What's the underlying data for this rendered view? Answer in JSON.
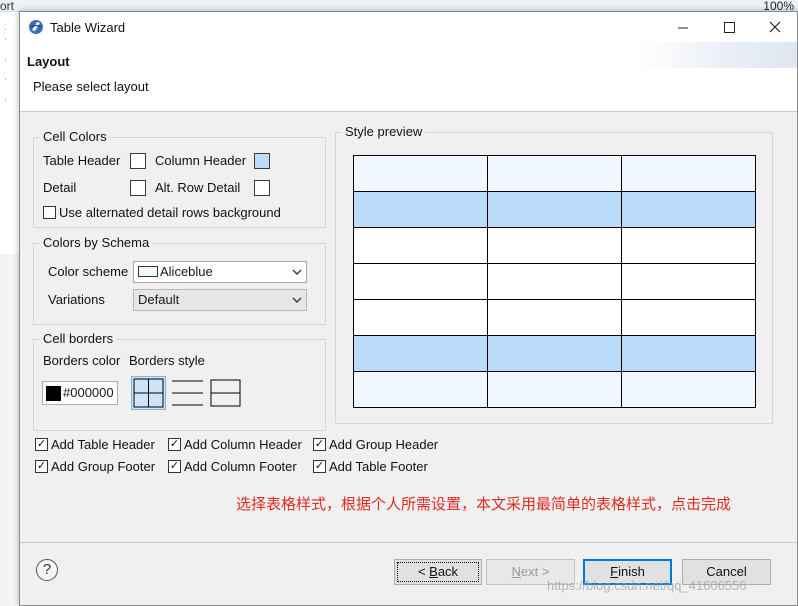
{
  "background": {
    "tab_fragment": "ort",
    "zoom": "100%"
  },
  "window": {
    "title": "Table Wizard",
    "controls": {
      "minimize": "—",
      "maximize": "☐",
      "close": "✕"
    }
  },
  "page": {
    "title": "Layout",
    "description": "Please select layout"
  },
  "cell_colors": {
    "group_label": "Cell Colors",
    "table_header_label": "Table Header",
    "column_header_label": "Column Header",
    "detail_label": "Detail",
    "alt_row_detail_label": "Alt. Row Detail",
    "alternated_checkbox_label": "Use alternated detail rows background",
    "colors": {
      "table_header": "#ffffff",
      "column_header": "#bbdcf8",
      "detail": "#ffffff",
      "alt_row_detail": "#ffffff"
    }
  },
  "schema": {
    "group_label": "Colors by Schema",
    "color_scheme_label": "Color scheme",
    "color_scheme_value": "Aliceblue",
    "variations_label": "Variations",
    "variations_value": "Default"
  },
  "cell_borders": {
    "group_label": "Cell borders",
    "borders_color_label": "Borders color",
    "borders_style_label": "Borders style",
    "color_value": "#000000"
  },
  "preview": {
    "group_label": "Style preview",
    "row_colors": [
      "#f0f7fe",
      "#bbdcf8",
      "#ffffff",
      "#ffffff",
      "#ffffff",
      "#bbdcf8",
      "#f0f7fe"
    ]
  },
  "options": [
    {
      "label": "Add Table Header",
      "checked": true
    },
    {
      "label": "Add Column Header",
      "checked": true
    },
    {
      "label": "Add Group Header",
      "checked": true
    },
    {
      "label": "Add Group Footer",
      "checked": true
    },
    {
      "label": "Add Column Footer",
      "checked": true
    },
    {
      "label": "Add Table Footer",
      "checked": true
    }
  ],
  "note": "选择表格样式，根据个人所需设置，本文采用最简单的表格样式，点击完成",
  "buttons": {
    "help": "?",
    "back_prefix": "< ",
    "back_underlined": "B",
    "back_rest": "ack",
    "next_underlined": "N",
    "next_rest": "ext >",
    "finish_underlined": "F",
    "finish_rest": "inish",
    "cancel": "Cancel"
  },
  "watermark": "https://blog.csdn.net/qq_41606556",
  "accent": "#0078d7"
}
